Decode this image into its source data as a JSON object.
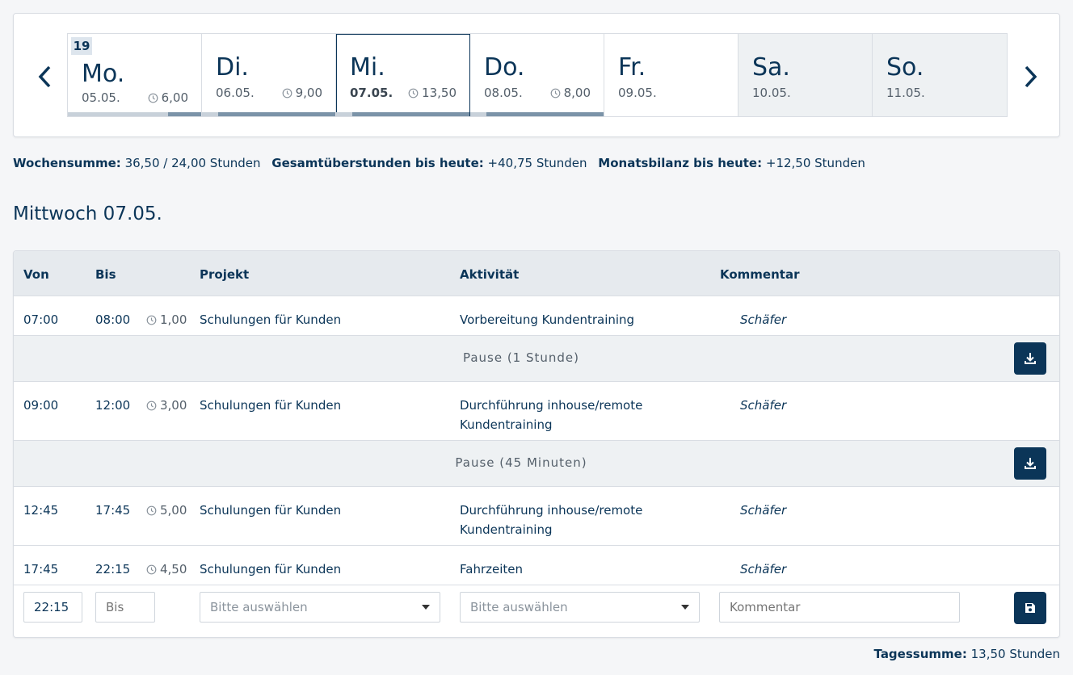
{
  "week": {
    "calendar_week": "19",
    "days": [
      {
        "name": "Mo.",
        "date": "05.05.",
        "hours": "6,00",
        "progress": 0.75,
        "weekend": false,
        "selected": false
      },
      {
        "name": "Di.",
        "date": "06.05.",
        "hours": "9,00",
        "progress": 1.0,
        "weekend": false,
        "selected": false
      },
      {
        "name": "Mi.",
        "date": "07.05.",
        "hours": "13,50",
        "progress": 1.0,
        "weekend": false,
        "selected": true
      },
      {
        "name": "Do.",
        "date": "08.05.",
        "hours": "8,00",
        "progress": 1.0,
        "weekend": false,
        "selected": false
      },
      {
        "name": "Fr.",
        "date": "09.05.",
        "hours": "",
        "progress": 0,
        "weekend": false,
        "selected": false
      },
      {
        "name": "Sa.",
        "date": "10.05.",
        "hours": "",
        "progress": 0,
        "weekend": true,
        "selected": false
      },
      {
        "name": "So.",
        "date": "11.05.",
        "hours": "",
        "progress": 0,
        "weekend": true,
        "selected": false
      }
    ]
  },
  "summary": {
    "week_label": "Wochensumme:",
    "week_value": "36,50 / 24,00 Stunden",
    "overtime_label": "Gesamtüberstunden bis heute:",
    "overtime_value": "+40,75 Stunden",
    "month_label": "Monatsbilanz bis heute:",
    "month_value": "+12,50 Stunden"
  },
  "day_title": "Mittwoch 07.05.",
  "table": {
    "headers": {
      "from": "Von",
      "to": "Bis",
      "project": "Projekt",
      "activity": "Aktivität",
      "comment": "Kommentar"
    },
    "entries": [
      {
        "from": "07:00",
        "to": "08:00",
        "duration": "1,00",
        "project": "Schulungen für Kunden",
        "activity": "Vorbereitung Kundentraining",
        "comment": "Schäfer"
      },
      {
        "from": "09:00",
        "to": "12:00",
        "duration": "3,00",
        "project": "Schulungen für Kunden",
        "activity": "Durchführung inhouse/remote Kundentraining",
        "comment": "Schäfer"
      },
      {
        "from": "12:45",
        "to": "17:45",
        "duration": "5,00",
        "project": "Schulungen für Kunden",
        "activity": "Durchführung inhouse/remote Kundentraining",
        "comment": "Schäfer"
      },
      {
        "from": "17:45",
        "to": "22:15",
        "duration": "4,50",
        "project": "Schulungen für Kunden",
        "activity": "Fahrzeiten",
        "comment": "Schäfer"
      }
    ],
    "pauses": [
      "Pause (1 Stunde)",
      "Pause (45 Minuten)"
    ],
    "new_entry": {
      "from_value": "22:15",
      "to_placeholder": "Bis",
      "project_placeholder": "Bitte auswählen",
      "activity_placeholder": "Bitte auswählen",
      "comment_placeholder": "Kommentar"
    }
  },
  "day_total": {
    "label": "Tagessumme:",
    "value": "13,50 Stunden"
  },
  "icons": {
    "prev": "chevron-left-icon",
    "next": "chevron-right-icon",
    "clock": "clock-icon",
    "download": "download-icon",
    "save": "save-icon",
    "dropdown": "caret-down-icon"
  },
  "colors": {
    "primary": "#0b3558",
    "weekend_bg": "#eef1f3",
    "header_bg": "#e6eaee",
    "progress_fill": "#7b93a8",
    "progress_track": "#c8d1da"
  }
}
